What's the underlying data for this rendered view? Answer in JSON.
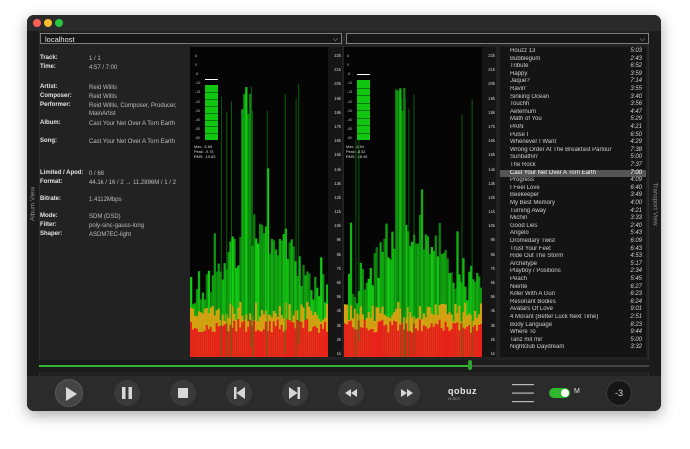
{
  "window": {
    "address": "localhost",
    "second_combo": "",
    "side_left_label": "Album View",
    "side_right_label": "Transport View"
  },
  "track_info": [
    {
      "key": "Track:",
      "value": "1 / 1"
    },
    {
      "key": "Time:",
      "value": "4:57 / 7:00"
    },
    {
      "key": "Artist:",
      "value": "Reid Willis"
    },
    {
      "key": "Composer:",
      "value": "Reid Willis"
    },
    {
      "key": "Performer:",
      "value": "Reid Willis, Composer, Producer, MainArtist"
    },
    {
      "key": "Album:",
      "value": "Cast Your Net Over A Torn Earth"
    },
    {
      "key": "Song:",
      "value": "Cast Your Net Over A Torn Earth"
    },
    {
      "key": "Limited / Apod:",
      "value": "0 / 68"
    },
    {
      "key": "Format:",
      "value": "44.1k / 16 / 2 → 11.2896M / 1 / 2"
    },
    {
      "key": "Bitrate:",
      "value": "1.4112Mbps"
    },
    {
      "key": "Mode:",
      "value": "SDM (DSD)"
    },
    {
      "key": "Filter:",
      "value": "poly-sinc-gauss-long"
    },
    {
      "key": "Shaper:",
      "value": "ASDM7EC-light"
    }
  ],
  "spectrum": {
    "freq_scale": [
      "22k",
      "21k",
      "20k",
      "19k",
      "18k",
      "17k",
      "16k",
      "15k",
      "14k",
      "13k",
      "12k",
      "11k",
      "10k",
      "9k",
      "8k",
      "7k",
      "6k",
      "5k",
      "4k",
      "3k",
      "2k",
      "1k"
    ],
    "vu_scale": [
      "6",
      "0",
      "-6",
      "-10",
      "-15",
      "-20",
      "-30",
      "-40",
      "-50",
      "-60"
    ],
    "left_meter": {
      "max": "Max: -5.66",
      "peak": "Peak: -9.75",
      "rms": "RMS: -19.83"
    },
    "right_meter": {
      "max": "Max: -4.54",
      "peak": "Peak: -8.52",
      "rms": "RMS: -18.45"
    },
    "colors": {
      "green": "#14d014",
      "red": "#e8201a",
      "black": "#050505"
    }
  },
  "playlist": [
    {
      "title": "Houzz 13",
      "duration": "5:03"
    },
    {
      "title": "Bubblegum",
      "duration": "2:43"
    },
    {
      "title": "Tribute",
      "duration": "6:52"
    },
    {
      "title": "Happy",
      "duration": "3:59"
    },
    {
      "title": "Jaque?",
      "duration": "7:14"
    },
    {
      "title": "Ravin'",
      "duration": "3:55"
    },
    {
      "title": "Sinking Ocean",
      "duration": "3:40"
    },
    {
      "title": "Touchh",
      "duration": "3:56"
    },
    {
      "title": "Aeternum",
      "duration": "4:47"
    },
    {
      "title": "Math of You",
      "duration": "5:29"
    },
    {
      "title": "PAIN",
      "duration": "4:21"
    },
    {
      "title": "Pulse I",
      "duration": "6:50"
    },
    {
      "title": "Whenever I Want",
      "duration": "4:29"
    },
    {
      "title": "Wrong Order At The Breakfast Parlour",
      "duration": "7:38"
    },
    {
      "title": "Sunbathin'",
      "duration": "5:00"
    },
    {
      "title": "The Rock",
      "duration": "7:37"
    },
    {
      "title": "Cast Your Net Over A Torn Earth",
      "duration": "7:00",
      "selected": true
    },
    {
      "title": "Progress",
      "duration": "4:09"
    },
    {
      "title": "I Feel Love",
      "duration": "6:40"
    },
    {
      "title": "Beekeeper",
      "duration": "3:49"
    },
    {
      "title": "My Best Memory",
      "duration": "4:00"
    },
    {
      "title": "Turning Away",
      "duration": "4:21"
    },
    {
      "title": "Michin",
      "duration": "3:33"
    },
    {
      "title": "Good Lies",
      "duration": "2:40"
    },
    {
      "title": "Angelo",
      "duration": "5:43"
    },
    {
      "title": "Dromedary Twist",
      "duration": "6:09"
    },
    {
      "title": "Trust Your Feet",
      "duration": "6:43"
    },
    {
      "title": "Ride Out The Storm",
      "duration": "4:53"
    },
    {
      "title": "Archetype",
      "duration": "5:17"
    },
    {
      "title": "Playboy / Positions",
      "duration": "2:34"
    },
    {
      "title": "Peach",
      "duration": "5:45"
    },
    {
      "title": "Niente",
      "duration": "6:27"
    },
    {
      "title": "Killer With A Gun",
      "duration": "6:23"
    },
    {
      "title": "Resonant Bodies",
      "duration": "6:24"
    },
    {
      "title": "Avatars Of Love",
      "duration": "9:01"
    },
    {
      "title": "4 Morant (Better Luck Next Time)",
      "duration": "2:51"
    },
    {
      "title": "Body Language",
      "duration": "8:23"
    },
    {
      "title": "Where To",
      "duration": "9:44"
    },
    {
      "title": "Tanz mit mir",
      "duration": "5:00"
    },
    {
      "title": "Nightclub Daydream",
      "duration": "3:32"
    }
  ],
  "progress": {
    "fraction": 0.707
  },
  "controls": {
    "qobuz_label": "qobuz",
    "qobuz_sub": "HI-RES",
    "m_label": "M",
    "volume": "-3",
    "accent": "#2eb82e"
  }
}
